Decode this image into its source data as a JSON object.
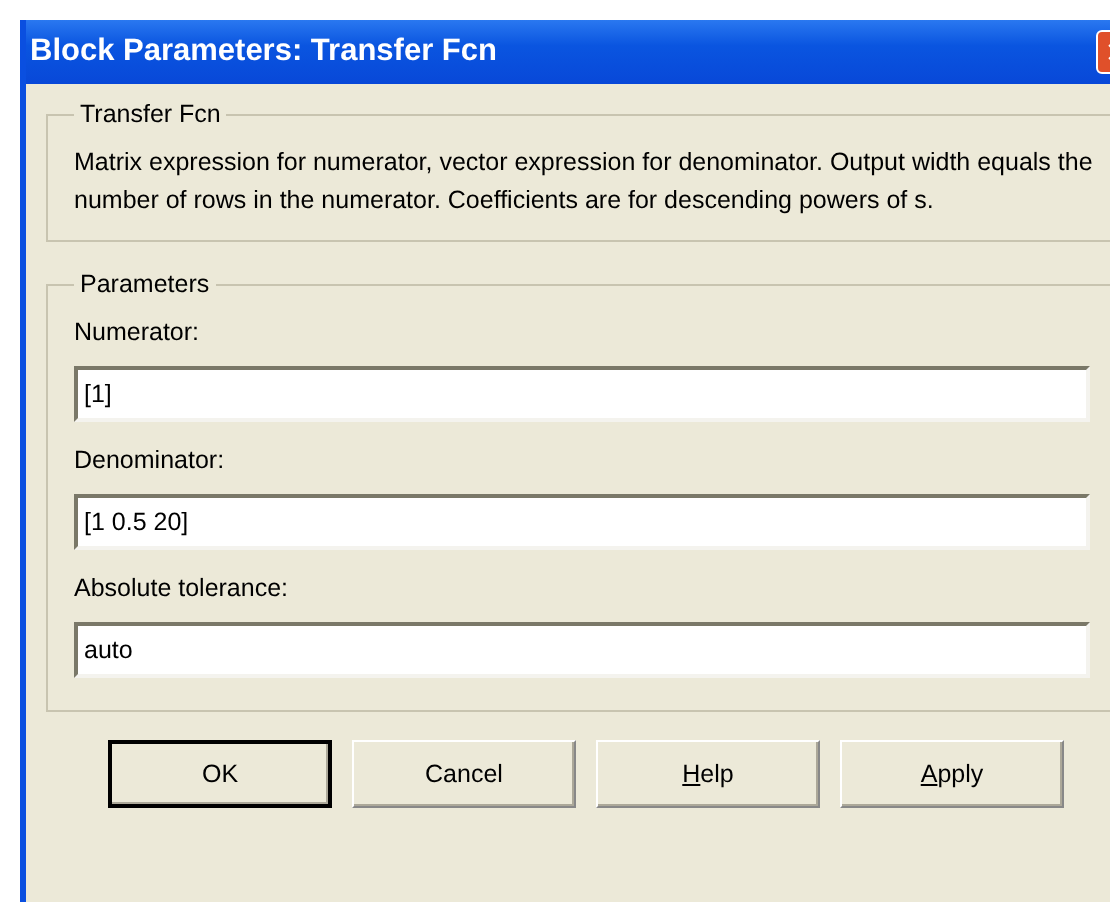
{
  "window": {
    "title": "Block Parameters: Transfer Fcn"
  },
  "description": {
    "title": "Transfer Fcn",
    "text": "Matrix expression for numerator, vector expression for denominator. Output width equals the number of rows in the numerator.  Coefficients are for descending powers of s."
  },
  "parameters": {
    "title": "Parameters",
    "fields": [
      {
        "label": "Numerator:",
        "value": "[1]"
      },
      {
        "label": "Denominator:",
        "value": "[1 0.5 20]"
      },
      {
        "label": "Absolute tolerance:",
        "value": "auto"
      }
    ]
  },
  "buttons": [
    {
      "label": "OK",
      "default": true,
      "underline_first": false
    },
    {
      "label": "Cancel",
      "default": false,
      "underline_first": false
    },
    {
      "label": "Help",
      "default": false,
      "underline_first": true
    },
    {
      "label": "Apply",
      "default": false,
      "underline_first": true
    }
  ]
}
